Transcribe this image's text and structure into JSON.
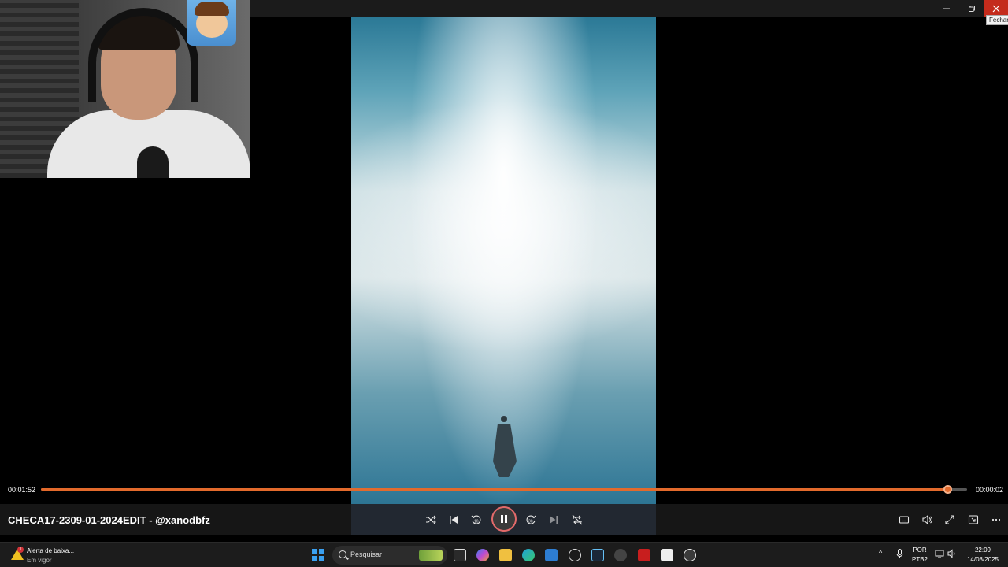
{
  "window": {
    "tooltip": "Fechar",
    "minimize_icon": "minimize-icon",
    "maximize_icon": "restore-icon",
    "close_icon": "close-icon"
  },
  "player": {
    "elapsed": "00:01:52",
    "remaining": "00:00:02",
    "progress_fraction": 0.979,
    "media_title": "CHECA17-2309-01-2024EDIT - @xanodbfz",
    "accent_color": "#e26a2c"
  },
  "controls": {
    "left": [
      "shuffle-icon",
      "previous-icon",
      "rewind-10-icon",
      "pause-icon",
      "forward-30-icon",
      "next-icon",
      "repeat-off-icon"
    ],
    "right": [
      "captions-icon",
      "volume-icon",
      "fullscreen-icon",
      "mini-player-icon",
      "more-icon"
    ]
  },
  "taskbar": {
    "notification_title": "Alerta de baixa...",
    "notification_subtitle": "Em vigor",
    "notification_badge": "1",
    "search_placeholder": "Pesquisar",
    "language_line1": "POR",
    "language_line2": "PTB2",
    "time": "22:09",
    "date": "14/08/2025"
  }
}
